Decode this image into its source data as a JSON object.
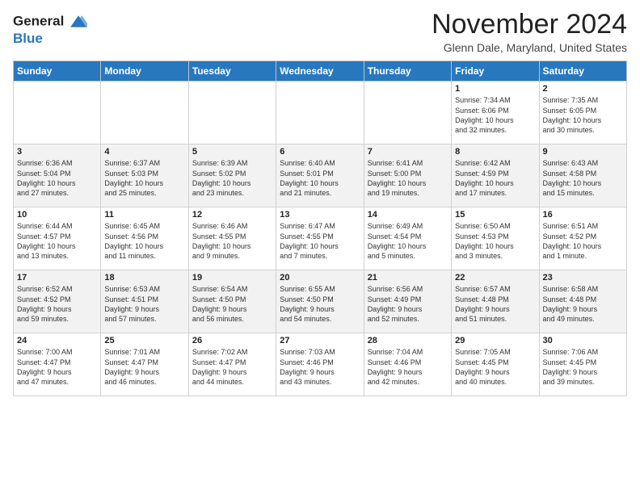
{
  "logo": {
    "line1": "General",
    "line2": "Blue"
  },
  "title": "November 2024",
  "location": "Glenn Dale, Maryland, United States",
  "header": {
    "days": [
      "Sunday",
      "Monday",
      "Tuesday",
      "Wednesday",
      "Thursday",
      "Friday",
      "Saturday"
    ]
  },
  "weeks": [
    [
      {
        "day": "",
        "info": ""
      },
      {
        "day": "",
        "info": ""
      },
      {
        "day": "",
        "info": ""
      },
      {
        "day": "",
        "info": ""
      },
      {
        "day": "",
        "info": ""
      },
      {
        "day": "1",
        "info": "Sunrise: 7:34 AM\nSunset: 6:06 PM\nDaylight: 10 hours\nand 32 minutes."
      },
      {
        "day": "2",
        "info": "Sunrise: 7:35 AM\nSunset: 6:05 PM\nDaylight: 10 hours\nand 30 minutes."
      }
    ],
    [
      {
        "day": "3",
        "info": "Sunrise: 6:36 AM\nSunset: 5:04 PM\nDaylight: 10 hours\nand 27 minutes."
      },
      {
        "day": "4",
        "info": "Sunrise: 6:37 AM\nSunset: 5:03 PM\nDaylight: 10 hours\nand 25 minutes."
      },
      {
        "day": "5",
        "info": "Sunrise: 6:39 AM\nSunset: 5:02 PM\nDaylight: 10 hours\nand 23 minutes."
      },
      {
        "day": "6",
        "info": "Sunrise: 6:40 AM\nSunset: 5:01 PM\nDaylight: 10 hours\nand 21 minutes."
      },
      {
        "day": "7",
        "info": "Sunrise: 6:41 AM\nSunset: 5:00 PM\nDaylight: 10 hours\nand 19 minutes."
      },
      {
        "day": "8",
        "info": "Sunrise: 6:42 AM\nSunset: 4:59 PM\nDaylight: 10 hours\nand 17 minutes."
      },
      {
        "day": "9",
        "info": "Sunrise: 6:43 AM\nSunset: 4:58 PM\nDaylight: 10 hours\nand 15 minutes."
      }
    ],
    [
      {
        "day": "10",
        "info": "Sunrise: 6:44 AM\nSunset: 4:57 PM\nDaylight: 10 hours\nand 13 minutes."
      },
      {
        "day": "11",
        "info": "Sunrise: 6:45 AM\nSunset: 4:56 PM\nDaylight: 10 hours\nand 11 minutes."
      },
      {
        "day": "12",
        "info": "Sunrise: 6:46 AM\nSunset: 4:55 PM\nDaylight: 10 hours\nand 9 minutes."
      },
      {
        "day": "13",
        "info": "Sunrise: 6:47 AM\nSunset: 4:55 PM\nDaylight: 10 hours\nand 7 minutes."
      },
      {
        "day": "14",
        "info": "Sunrise: 6:49 AM\nSunset: 4:54 PM\nDaylight: 10 hours\nand 5 minutes."
      },
      {
        "day": "15",
        "info": "Sunrise: 6:50 AM\nSunset: 4:53 PM\nDaylight: 10 hours\nand 3 minutes."
      },
      {
        "day": "16",
        "info": "Sunrise: 6:51 AM\nSunset: 4:52 PM\nDaylight: 10 hours\nand 1 minute."
      }
    ],
    [
      {
        "day": "17",
        "info": "Sunrise: 6:52 AM\nSunset: 4:52 PM\nDaylight: 9 hours\nand 59 minutes."
      },
      {
        "day": "18",
        "info": "Sunrise: 6:53 AM\nSunset: 4:51 PM\nDaylight: 9 hours\nand 57 minutes."
      },
      {
        "day": "19",
        "info": "Sunrise: 6:54 AM\nSunset: 4:50 PM\nDaylight: 9 hours\nand 56 minutes."
      },
      {
        "day": "20",
        "info": "Sunrise: 6:55 AM\nSunset: 4:50 PM\nDaylight: 9 hours\nand 54 minutes."
      },
      {
        "day": "21",
        "info": "Sunrise: 6:56 AM\nSunset: 4:49 PM\nDaylight: 9 hours\nand 52 minutes."
      },
      {
        "day": "22",
        "info": "Sunrise: 6:57 AM\nSunset: 4:48 PM\nDaylight: 9 hours\nand 51 minutes."
      },
      {
        "day": "23",
        "info": "Sunrise: 6:58 AM\nSunset: 4:48 PM\nDaylight: 9 hours\nand 49 minutes."
      }
    ],
    [
      {
        "day": "24",
        "info": "Sunrise: 7:00 AM\nSunset: 4:47 PM\nDaylight: 9 hours\nand 47 minutes."
      },
      {
        "day": "25",
        "info": "Sunrise: 7:01 AM\nSunset: 4:47 PM\nDaylight: 9 hours\nand 46 minutes."
      },
      {
        "day": "26",
        "info": "Sunrise: 7:02 AM\nSunset: 4:47 PM\nDaylight: 9 hours\nand 44 minutes."
      },
      {
        "day": "27",
        "info": "Sunrise: 7:03 AM\nSunset: 4:46 PM\nDaylight: 9 hours\nand 43 minutes."
      },
      {
        "day": "28",
        "info": "Sunrise: 7:04 AM\nSunset: 4:46 PM\nDaylight: 9 hours\nand 42 minutes."
      },
      {
        "day": "29",
        "info": "Sunrise: 7:05 AM\nSunset: 4:45 PM\nDaylight: 9 hours\nand 40 minutes."
      },
      {
        "day": "30",
        "info": "Sunrise: 7:06 AM\nSunset: 4:45 PM\nDaylight: 9 hours\nand 39 minutes."
      }
    ]
  ]
}
